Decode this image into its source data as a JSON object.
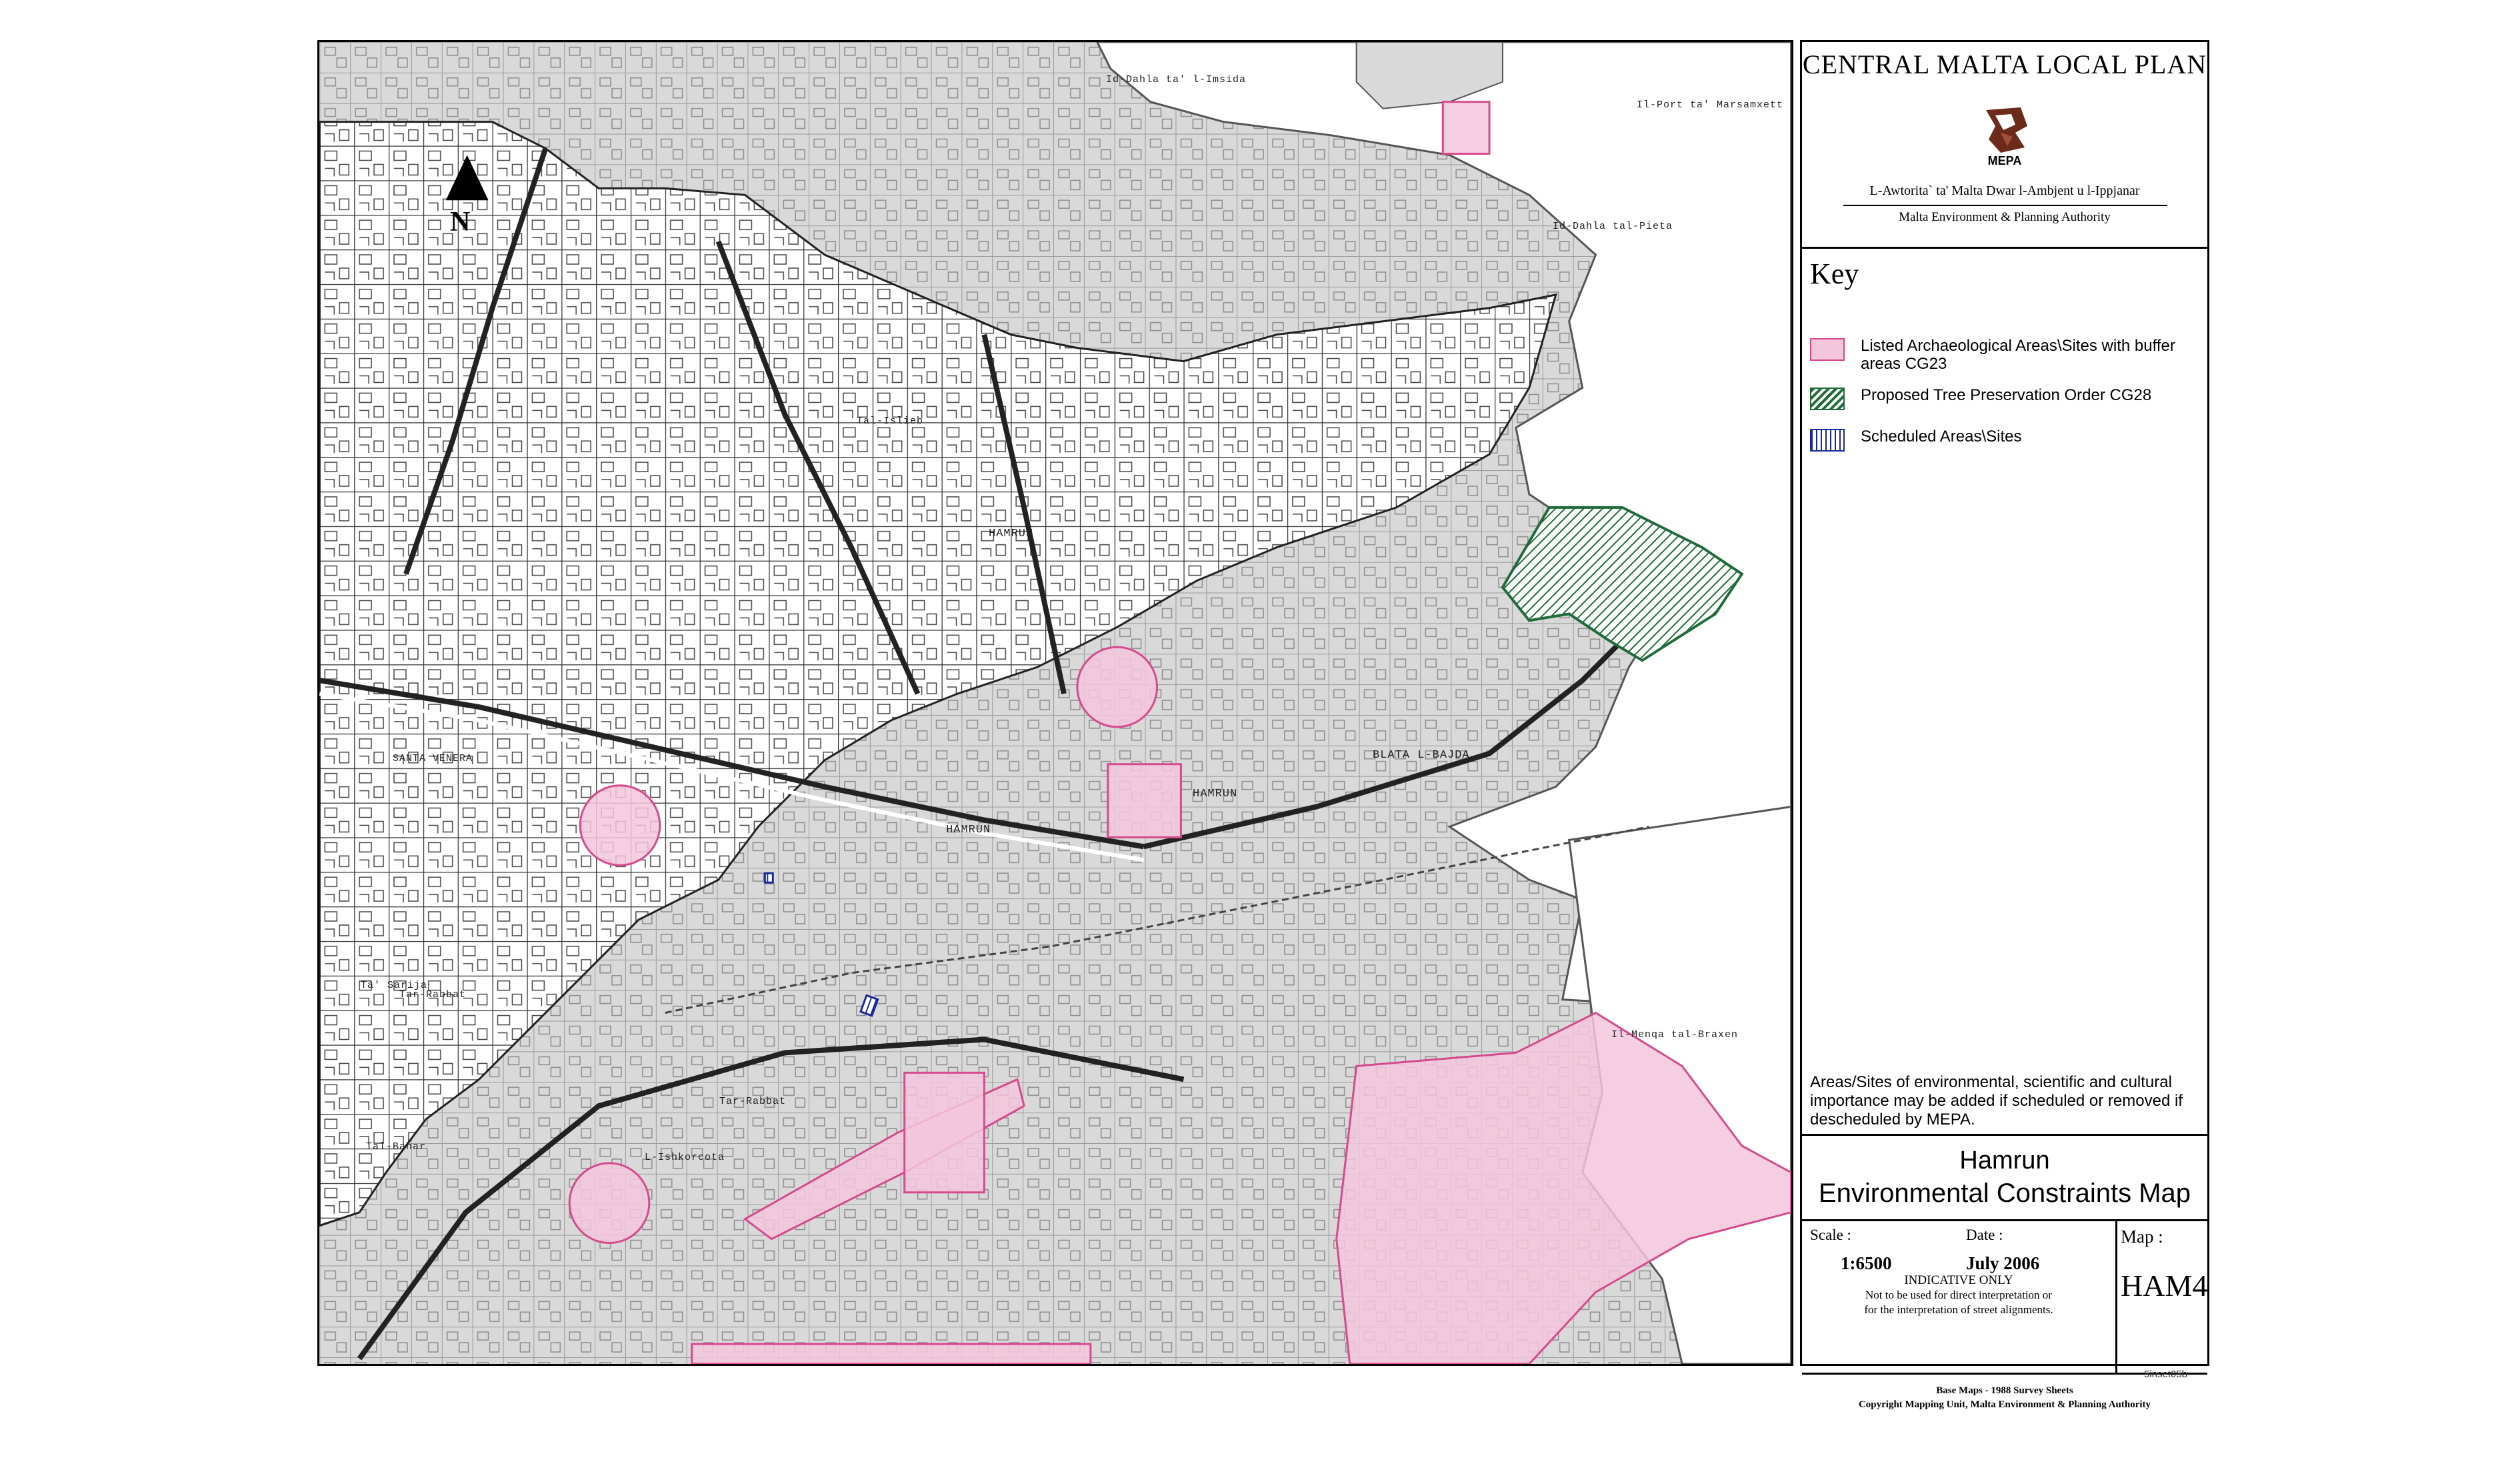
{
  "map": {
    "north_label": "N",
    "places": [
      {
        "name": "Id-Dahla ta' l-Imsida",
        "key": "dahla"
      },
      {
        "name": "Il-Port ta' Marsamxett",
        "key": "port"
      },
      {
        "name": "Id-Dahla tal-Pieta",
        "key": "pieta"
      },
      {
        "name": "Tal-Islieb",
        "key": "islieb"
      },
      {
        "name": "HAMRUN",
        "key": "hamrun1"
      },
      {
        "name": "HAMRUN",
        "key": "hamrun2"
      },
      {
        "name": "BLATA L-BAJDA",
        "key": "blata"
      },
      {
        "name": "HAMRUN",
        "key": "hamrun3"
      },
      {
        "name": "SANTA VENERA",
        "key": "venera"
      },
      {
        "name": "Ta' Sarija",
        "key": "sarija"
      },
      {
        "name": "Tar-Rabbat",
        "key": "rabbat1"
      },
      {
        "name": "Tar-Rabbat",
        "key": "rabbat2"
      },
      {
        "name": "L-Ishkorcota",
        "key": "ishkorcota"
      },
      {
        "name": "Tal-Bahar",
        "key": "bahar"
      },
      {
        "name": "Il-Menqa tal-Braxen",
        "key": "menqa"
      }
    ]
  },
  "legend": {
    "plan_title": "CENTRAL MALTA LOCAL PLAN",
    "logo_word": "MEPA",
    "authority_mt": "L-Awtorita` ta' Malta Dwar l-Ambjent u l-Ippjanar",
    "authority_en": "Malta Environment & Planning Authority",
    "key_title": "Key",
    "items": [
      {
        "label": "Listed Archaeological Areas\\Sites with buffer areas CG23",
        "color": "#f4c6dc",
        "pattern": "solid",
        "border": "#d64a8f"
      },
      {
        "label": "Proposed Tree Preservation Order CG28",
        "color": "#1f6b3a",
        "pattern": "diagonal",
        "border": "#1f6b3a"
      },
      {
        "label": "Scheduled Areas\\Sites",
        "color": "#1a2a9a",
        "pattern": "vertical",
        "border": "#1a2a9a"
      }
    ],
    "note": "Areas/Sites of environmental, scientific and cultural importance may be added if scheduled or removed if descheduled by MEPA.",
    "map_place": "Hamrun",
    "map_name": "Environmental Constraints Map",
    "scale_label": "Scale :",
    "scale_value": "1:6500",
    "date_label": "Date :",
    "date_value": "July 2006",
    "map_label": "Map :",
    "map_number": "HAM4",
    "indicative_1": "INDICATIVE ONLY",
    "indicative_2": "Not to be used for direct interpretation or",
    "indicative_3": "for the interpretation of street alignments.",
    "base_maps": "Base Maps - 1988 Survey Sheets",
    "copyright": "Copyright Mapping Unit, Malta Environment & Planning Authority",
    "sheet_ref": "5inset05b"
  },
  "colors": {
    "built_grey": "#d9d9d9",
    "urban_white": "#ffffff",
    "sea_white": "#ffffff",
    "archaeological_pink": "#f4c6dc",
    "archaeological_edge": "#d64a8f",
    "tree_green": "#1f6b3a",
    "scheduled_blue": "#1a2a9a"
  }
}
